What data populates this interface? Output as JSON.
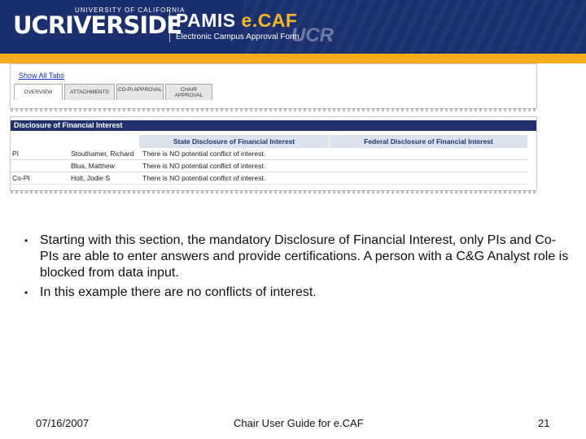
{
  "header": {
    "university_small": "UNIVERSITY OF CALIFORNIA",
    "university_logo": "UCRIVERSIDE",
    "app_name_prefix": "PAMIS ",
    "app_name_accent": "e.CAF",
    "app_subtitle": "Electronic Campus Approval Form",
    "watermark": "UCR"
  },
  "tabs": {
    "show_all_label": "Show All Tabs",
    "items": [
      {
        "label": "OVERVIEW"
      },
      {
        "label": "ATTACHMENTS"
      },
      {
        "label": "CO-PI APPROVAL"
      },
      {
        "label": "CHAIR APPROVAL"
      }
    ]
  },
  "disclosure": {
    "section_title": "Disclosure of Financial Interest",
    "columns": {
      "state": "State Disclosure of Financial Interest",
      "federal": "Federal Disclosure of Financial Interest"
    },
    "rows": [
      {
        "role": "PI",
        "name": "Stouthamer, Richard",
        "state": "There is NO potential conflict of interest.",
        "federal": ""
      },
      {
        "role": "",
        "name": "Blua, Matthew",
        "state": "There is NO potential conflict of interest.",
        "federal": ""
      },
      {
        "role": "Co-PI",
        "name": "Holt, Jodie S",
        "state": "There is NO potential conflict of interest.",
        "federal": ""
      }
    ]
  },
  "bullets": [
    "Starting with this section, the mandatory Disclosure of Financial Interest, only PIs and Co-PIs are able to enter answers and provide certifications. A person with a C&G Analyst role is blocked from data input.",
    "In this example there are no conflicts of interest."
  ],
  "bullet_symbol": "•",
  "footer": {
    "date": "07/16/2007",
    "title": "Chair User Guide for e.CAF",
    "page": "21"
  },
  "colors": {
    "banner": "#1b2f6e",
    "gold": "#f3ac1a",
    "table_header": "#1f326e"
  }
}
